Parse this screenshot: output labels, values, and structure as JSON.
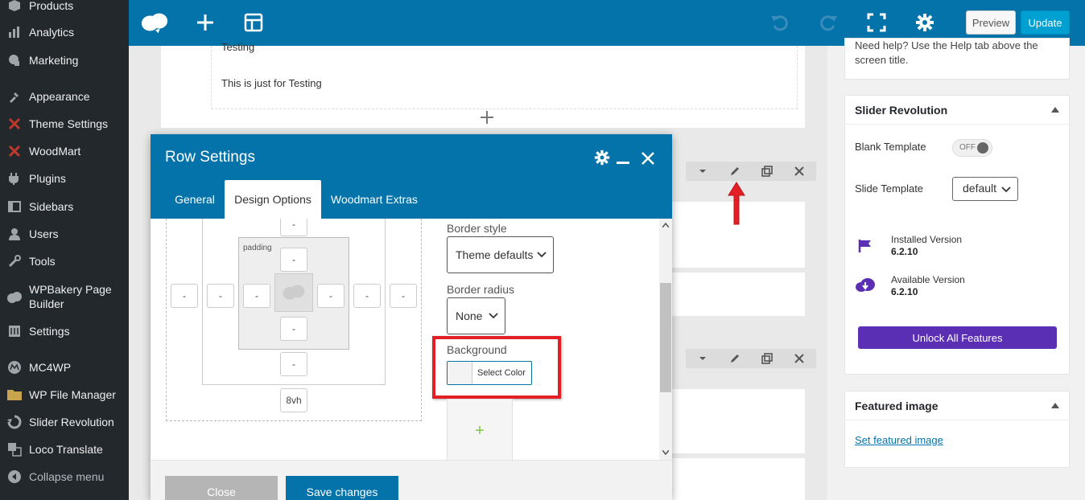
{
  "sidebar": {
    "items": [
      {
        "label": "Products",
        "icon": "products-icon"
      },
      {
        "label": "Analytics",
        "icon": "analytics-icon"
      },
      {
        "label": "Marketing",
        "icon": "marketing-icon"
      },
      {
        "label": "Appearance",
        "icon": "appearance-icon"
      },
      {
        "label": "Theme Settings",
        "icon": "theme-settings-icon"
      },
      {
        "label": "WoodMart",
        "icon": "woodmart-icon"
      },
      {
        "label": "Plugins",
        "icon": "plugins-icon"
      },
      {
        "label": "Sidebars",
        "icon": "sidebars-icon"
      },
      {
        "label": "Users",
        "icon": "users-icon"
      },
      {
        "label": "Tools",
        "icon": "tools-icon"
      },
      {
        "label": "WPBakery Page\nBuilder",
        "icon": "wpbakery-icon"
      },
      {
        "label": "Settings",
        "icon": "settings-icon"
      },
      {
        "label": "MC4WP",
        "icon": "mc4wp-icon"
      },
      {
        "label": "WP File Manager",
        "icon": "folder-icon"
      },
      {
        "label": "Slider Revolution",
        "icon": "slider-revolution-icon"
      },
      {
        "label": "Loco Translate",
        "icon": "translate-icon"
      },
      {
        "label": "Collapse menu",
        "icon": "collapse-icon"
      }
    ]
  },
  "topbar": {
    "preview_label": "Preview",
    "update_label": "Update",
    "accent": "#0473aa"
  },
  "editor": {
    "text_line1": "Testing",
    "text_line2": "This is just for Testing"
  },
  "modal": {
    "title": "Row Settings",
    "tabs": [
      "General",
      "Design Options",
      "Woodmart Extras"
    ],
    "active_tab": "Design Options",
    "box_model": {
      "padding_label": "padding",
      "placeholder": "-",
      "bottom_value": "8vh"
    },
    "border_style": {
      "label": "Border style",
      "value": "Theme defaults"
    },
    "border_radius": {
      "label": "Border radius",
      "value": "None"
    },
    "background": {
      "label": "Background",
      "button": "Select Color"
    },
    "add_image": "+",
    "close_label": "Close",
    "save_label": "Save changes"
  },
  "right_sidebar": {
    "help_text": "Need help? Use the Help tab above the screen title.",
    "slider_revolution": {
      "title": "Slider Revolution",
      "blank_template_label": "Blank Template",
      "blank_template_toggle": "OFF",
      "slide_template_label": "Slide Template",
      "slide_template_value": "default",
      "installed_label": "Installed Version",
      "installed_value": "6.2.10",
      "available_label": "Available Version",
      "available_value": "6.2.10",
      "unlock_label": "Unlock All Features",
      "unlock_color": "#5b2fb3"
    },
    "featured_image": {
      "title": "Featured image",
      "link": "Set featured image"
    }
  },
  "highlight_color": "#e31e24"
}
